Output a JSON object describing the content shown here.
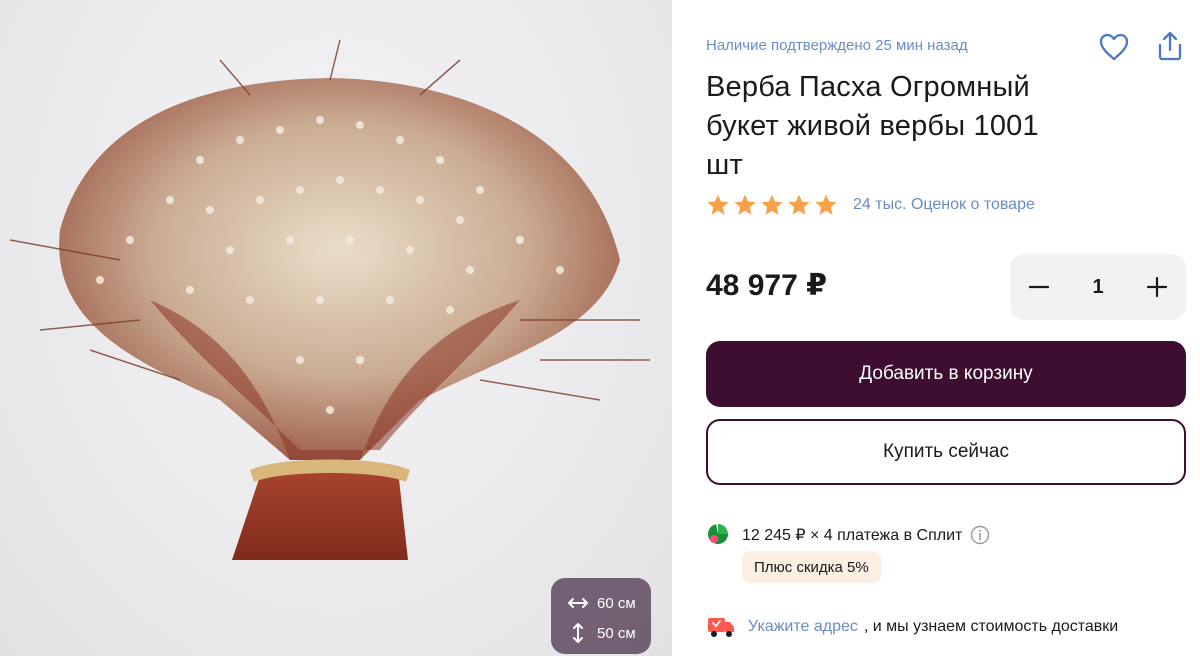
{
  "image": {
    "alt_icon": "product-photo-pussy-willow-bouquet",
    "dimensions": {
      "width_label": "60 см",
      "height_label": "50 см"
    }
  },
  "product": {
    "availability": "Наличие подтверждено 25 мин назад",
    "title_lines": [
      "Верба Пасха Огромный",
      "букет живой вербы 1001",
      "шт"
    ],
    "rating": {
      "stars": 5,
      "text": "24 тыс. Оценок о товаре"
    },
    "price": "48 977 ₽",
    "quantity": "1"
  },
  "actions": {
    "add_to_cart": "Добавить в корзину",
    "buy_now": "Купить сейчас"
  },
  "split": {
    "text": "12 245 ₽ × 4 платежа в Сплит",
    "discount": "Плюс скидка 5%"
  },
  "delivery": {
    "link": "Укажите адрес",
    "text": ", и мы узнаем стоимость доставки"
  },
  "colors": {
    "accent_dark": "#3d0e30",
    "link_blue": "#6a8cc6",
    "star_orange": "#f7a24a",
    "split_green": "#2cb34a",
    "discount_bg": "#fbeee3"
  }
}
